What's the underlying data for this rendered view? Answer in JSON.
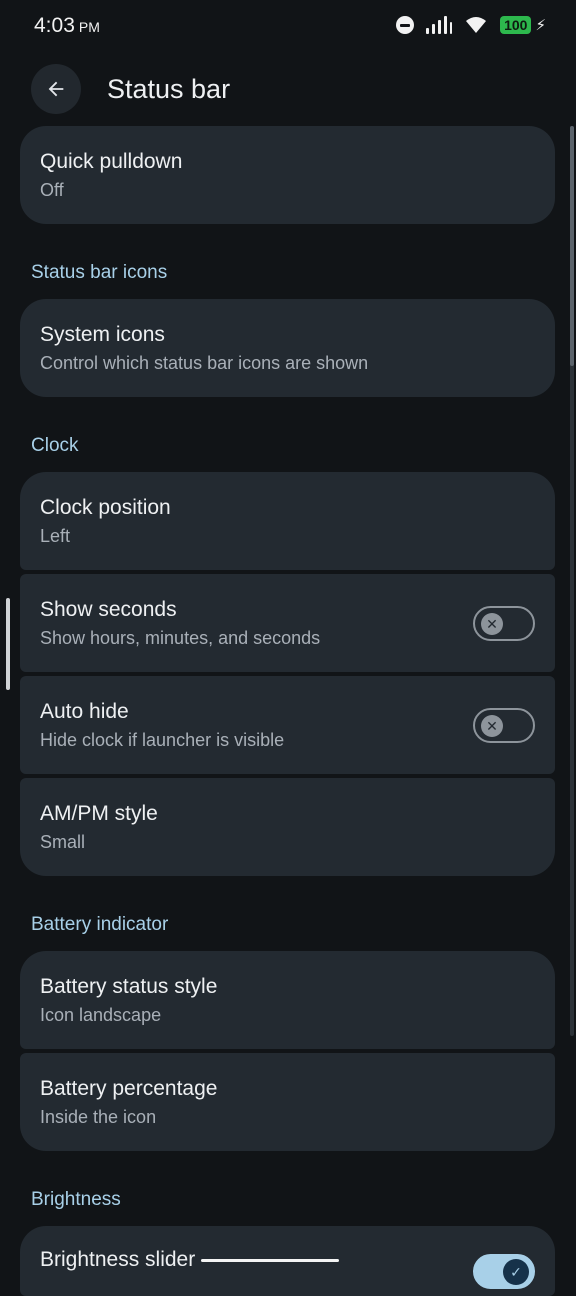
{
  "status_bar": {
    "time": "4:03",
    "ampm": "PM",
    "battery": "100"
  },
  "header": {
    "title": "Status bar",
    "back_icon": "arrow-left-icon"
  },
  "quick_pulldown": {
    "title": "Quick pulldown",
    "value": "Off"
  },
  "sections": {
    "status_bar_icons": "Status bar icons",
    "clock": "Clock",
    "battery_indicator": "Battery indicator",
    "brightness": "Brightness"
  },
  "system_icons": {
    "title": "System icons",
    "subtitle": "Control which status bar icons are shown"
  },
  "clock_position": {
    "title": "Clock position",
    "value": "Left"
  },
  "show_seconds": {
    "title": "Show seconds",
    "subtitle": "Show hours, minutes, and seconds",
    "enabled": false
  },
  "auto_hide": {
    "title": "Auto hide",
    "subtitle": "Hide clock if launcher is visible",
    "enabled": false
  },
  "ampm_style": {
    "title": "AM/PM style",
    "value": "Small"
  },
  "battery_status_style": {
    "title": "Battery status style",
    "value": "Icon landscape"
  },
  "battery_percentage": {
    "title": "Battery percentage",
    "value": "Inside the icon"
  },
  "brightness_slider": {
    "title": "Brightness slider",
    "enabled": true
  },
  "colors": {
    "accent": "#a8d0e8",
    "card": "#232a31",
    "background": "#111417",
    "battery": "#2db84d"
  }
}
